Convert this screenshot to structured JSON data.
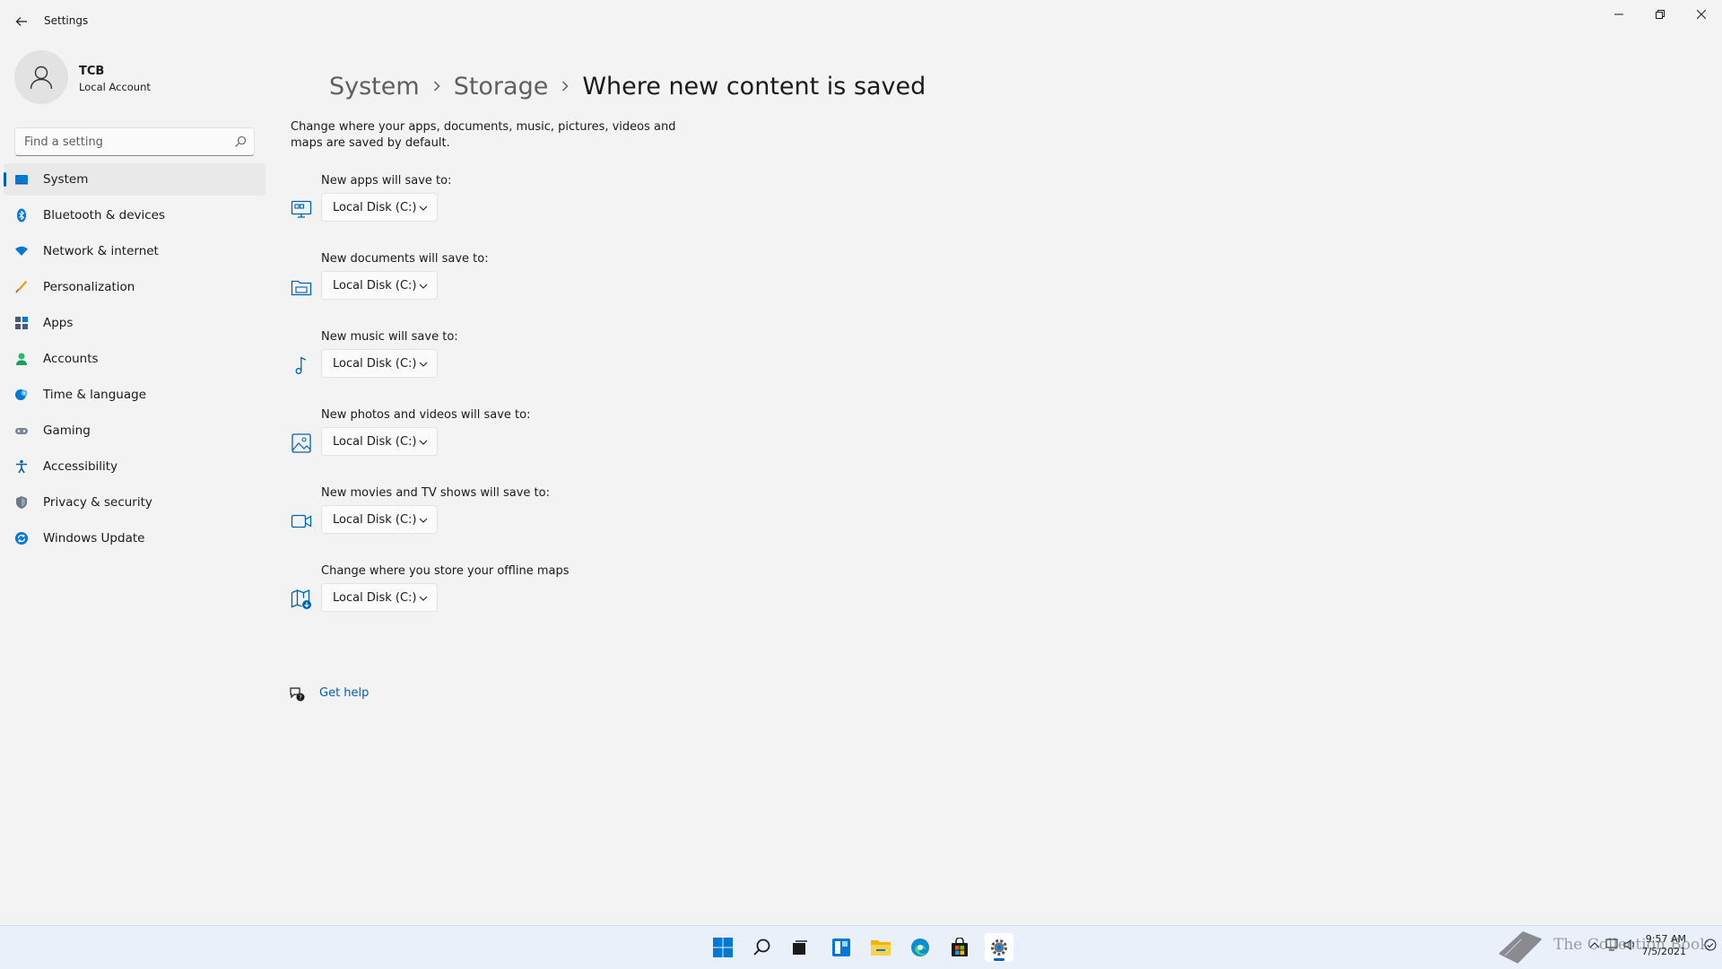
{
  "window": {
    "app_title": "Settings",
    "controls": {
      "minimize_icon": "minimize-icon",
      "maximize_icon": "restore-icon",
      "close_icon": "close-icon"
    }
  },
  "profile": {
    "name": "TCB",
    "account_type": "Local Account"
  },
  "search": {
    "placeholder": "Find a setting",
    "value": ""
  },
  "sidebar": {
    "items": [
      {
        "label": "System",
        "icon": "system-icon",
        "selected": true
      },
      {
        "label": "Bluetooth & devices",
        "icon": "bluetooth-icon",
        "selected": false
      },
      {
        "label": "Network & internet",
        "icon": "network-icon",
        "selected": false
      },
      {
        "label": "Personalization",
        "icon": "personalization-icon",
        "selected": false
      },
      {
        "label": "Apps",
        "icon": "apps-icon",
        "selected": false
      },
      {
        "label": "Accounts",
        "icon": "accounts-icon",
        "selected": false
      },
      {
        "label": "Time & language",
        "icon": "time-language-icon",
        "selected": false
      },
      {
        "label": "Gaming",
        "icon": "gaming-icon",
        "selected": false
      },
      {
        "label": "Accessibility",
        "icon": "accessibility-icon",
        "selected": false
      },
      {
        "label": "Privacy & security",
        "icon": "privacy-icon",
        "selected": false
      },
      {
        "label": "Windows Update",
        "icon": "windows-update-icon",
        "selected": false
      }
    ]
  },
  "breadcrumb": {
    "level1": "System",
    "level2": "Storage",
    "current": "Where new content is saved"
  },
  "description": "Change where your apps, documents, music, pictures, videos and maps are saved by default.",
  "settings": [
    {
      "label": "New apps will save to:",
      "value": "Local Disk (C:)",
      "icon": "apps-save-icon"
    },
    {
      "label": "New documents will save to:",
      "value": "Local Disk (C:)",
      "icon": "documents-folder-icon"
    },
    {
      "label": "New music will save to:",
      "value": "Local Disk (C:)",
      "icon": "music-note-icon"
    },
    {
      "label": "New photos and videos will save to:",
      "value": "Local Disk (C:)",
      "icon": "photo-icon"
    },
    {
      "label": "New movies and TV shows will save to:",
      "value": "Local Disk (C:)",
      "icon": "video-camera-icon"
    },
    {
      "label": "Change where you store your offline maps",
      "value": "Local Disk (C:)",
      "icon": "offline-maps-icon"
    }
  ],
  "help": {
    "label": "Get help"
  },
  "taskbar": {
    "apps": [
      "start-icon",
      "search-icon",
      "task-view-icon",
      "widgets-icon",
      "file-explorer-icon",
      "edge-icon",
      "store-icon",
      "settings-icon"
    ],
    "active_app": "settings-icon",
    "clock_time": "9:57 AM",
    "clock_date": "7/5/2021"
  },
  "watermark": {
    "text": "The Collection Book"
  },
  "colors": {
    "accent": "#005fb8",
    "background": "#f3f3f3",
    "taskbar": "#eaf0fa"
  }
}
